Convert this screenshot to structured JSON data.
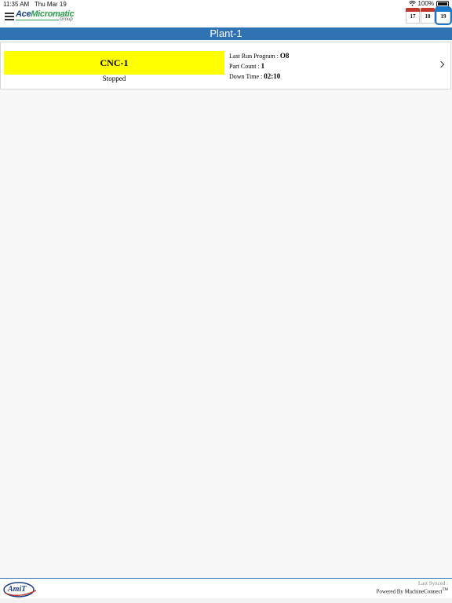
{
  "status_bar": {
    "time": "11:35 AM",
    "date": "Thu Mar 19",
    "battery": "100%"
  },
  "header": {
    "logo_brand_part1": "Ace",
    "logo_brand_part2": "Micromatic",
    "logo_subtitle": "Group",
    "calendar_days": [
      "17",
      "18",
      "19"
    ],
    "active_day": "19"
  },
  "page": {
    "title": "Plant-1"
  },
  "machines": [
    {
      "name": "CNC-1",
      "status": "Stopped",
      "status_color": "#ffff00",
      "last_run_label": "Last Run Program : ",
      "last_run_value": "O8",
      "part_count_label": "Part Count : ",
      "part_count_value": "1",
      "down_time_label": "Down Time : ",
      "down_time_value": "02:10"
    }
  ],
  "footer": {
    "logo_text": "AmiT",
    "last_synced_label": "Last Synced :",
    "powered_by": "Powered By MachineConnect",
    "trademark": "TM"
  },
  "colors": {
    "accent": "#2f73b5",
    "status_stopped": "#ffff00"
  }
}
